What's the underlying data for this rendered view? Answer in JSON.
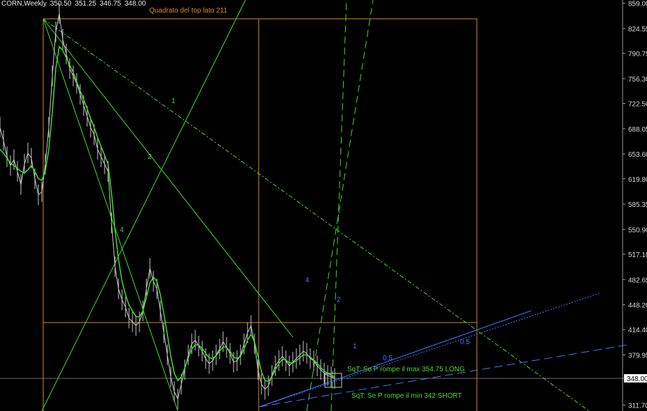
{
  "header": {
    "symbol_tf": "CORN,Weekly",
    "ohlc": [
      "350.50",
      "351.25",
      "346.75",
      "348.00"
    ]
  },
  "colors": {
    "background": "#000000",
    "price": "#c8c8c8",
    "ma": "#3fdc2e",
    "green": "#3fdc2e",
    "orange": "#d98b1e",
    "blue": "#3a78ff",
    "axis_text": "#d8d8d8",
    "current_price_box": "#ffffff",
    "current_price_text": "#000000"
  },
  "chart_data": {
    "type": "line",
    "symbol": "CORN",
    "timeframe": "Weekly",
    "ylim": [
      303.5,
      863.5
    ],
    "y_ticks": [
      859.0,
      824.55,
      790.75,
      756.3,
      722.5,
      688.05,
      653.6,
      619.8,
      585.35,
      550.9,
      517.1,
      482.65,
      448.2,
      414.4,
      379.95,
      348.0,
      311.7
    ],
    "current_price": 348.0,
    "price_series_note": "weekly closes, sampled",
    "price": [
      690,
      672,
      650,
      638,
      646,
      630,
      612,
      640,
      655,
      648,
      620,
      598,
      602,
      640,
      690,
      760,
      820,
      845,
      810,
      790,
      770,
      760,
      750,
      735,
      720,
      705,
      690,
      680,
      660,
      650,
      640,
      630,
      560,
      500,
      470,
      455,
      445,
      430,
      425,
      420,
      425,
      440,
      470,
      498,
      480,
      470,
      440,
      410,
      380,
      350,
      330,
      320,
      340,
      360,
      380,
      395,
      400,
      392,
      385,
      375,
      368,
      372,
      380,
      388,
      398,
      390,
      382,
      370,
      372,
      380,
      395,
      410,
      420,
      395,
      360,
      340,
      333,
      338,
      352,
      365,
      372,
      378,
      372,
      365,
      370,
      375,
      380,
      385,
      382,
      375,
      372,
      365,
      360,
      355,
      352,
      350,
      348
    ],
    "moving_average": [
      660,
      655,
      648,
      641,
      638,
      634,
      630,
      628,
      632,
      638,
      630,
      620,
      618,
      630,
      660,
      710,
      770,
      800,
      795,
      785,
      775,
      765,
      752,
      740,
      728,
      715,
      702,
      690,
      676,
      664,
      652,
      640,
      600,
      550,
      510,
      480,
      462,
      448,
      440,
      432,
      432,
      440,
      458,
      478,
      486,
      480,
      462,
      436,
      408,
      378,
      355,
      345,
      350,
      362,
      376,
      388,
      394,
      393,
      389,
      382,
      376,
      375,
      379,
      385,
      391,
      390,
      385,
      377,
      375,
      378,
      388,
      400,
      408,
      398,
      378,
      357,
      345,
      344,
      350,
      360,
      368,
      374,
      373,
      369,
      369,
      372,
      376,
      380,
      380,
      377,
      373,
      368,
      363,
      358,
      355,
      352,
      350
    ],
    "annotations": [
      {
        "text": "Quadrato del top lato 211",
        "color": "orange"
      },
      {
        "text": "1",
        "color": "green"
      },
      {
        "text": "2",
        "color": "green"
      },
      {
        "text": "4",
        "color": "green"
      },
      {
        "text": "4",
        "color": "blue"
      },
      {
        "text": "2",
        "color": "blue"
      },
      {
        "text": "1",
        "color": "blue"
      },
      {
        "text": "0.5",
        "color": "blue"
      },
      {
        "text": "0.5",
        "color": "blue"
      },
      {
        "text": "SqT: Se P rompe il max 354.75 LONG",
        "color": "green"
      },
      {
        "text": "SqT: Se P rompe il min 342 SHORT",
        "color": "green"
      }
    ]
  }
}
